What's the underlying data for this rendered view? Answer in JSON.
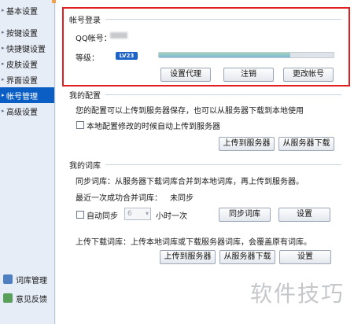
{
  "sidebar": {
    "items": [
      {
        "label": "基本设置",
        "active": false
      },
      {
        "label": "按键设置",
        "active": false
      },
      {
        "label": "快捷键设置",
        "active": false
      },
      {
        "label": "皮肤设置",
        "active": false
      },
      {
        "label": "界面设置",
        "active": false
      },
      {
        "label": "帐号管理",
        "active": true
      },
      {
        "label": "高级设置",
        "active": false
      }
    ],
    "bottom": [
      {
        "label": "词库管理",
        "icon": "dictionary-icon"
      },
      {
        "label": "意见反馈",
        "icon": "feedback-icon"
      }
    ]
  },
  "account_login": {
    "title": "帐号登录",
    "qq_label": "QQ帐号：",
    "level_label": "等级：",
    "level_badge": "LV23",
    "level_progress": 0.75,
    "buttons": {
      "proxy": "设置代理",
      "logout": "注销",
      "change": "更改帐号"
    }
  },
  "my_config": {
    "title": "我的配置",
    "description": "您的配置可以上传到服务器保存，也可以从服务器下载到本地使用",
    "auto_upload_label": "本地配置修改的时候自动上传到服务器",
    "upload_button": "上传到服务器",
    "download_button": "从服务器下载"
  },
  "my_dict": {
    "title": "我的词库",
    "sync_desc": "同步词库：从服务器下载词库合并到本地词库，再上传到服务器。",
    "last_merge_label": "最近一次成功合并词库：",
    "last_merge_value": "未同步",
    "auto_sync_label": "自动同步",
    "auto_sync_value": "6",
    "interval_unit": "小时一次",
    "sync_button": "同步词库",
    "sync_settings_button": "设置",
    "upload_download_desc": "上传下载词库：上传本地词库或下载服务器词库，会覆盖原有词库。",
    "upload_button": "上传到服务器",
    "download_button": "从服务器下载",
    "settings_button": "设置"
  },
  "watermark": "软件技巧",
  "colors": {
    "accent": "#0b5fc4",
    "highlight": "#e02020"
  }
}
